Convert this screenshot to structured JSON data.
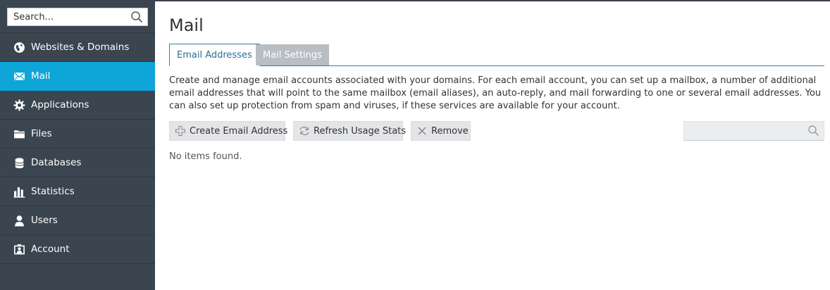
{
  "sidebar": {
    "search_placeholder": "Search...",
    "items": [
      {
        "label": "Websites & Domains",
        "icon": "globe-icon",
        "active": false
      },
      {
        "label": "Mail",
        "icon": "envelope-icon",
        "active": true
      },
      {
        "label": "Applications",
        "icon": "gear-icon",
        "active": false
      },
      {
        "label": "Files",
        "icon": "folder-icon",
        "active": false
      },
      {
        "label": "Databases",
        "icon": "database-icon",
        "active": false
      },
      {
        "label": "Statistics",
        "icon": "bar-chart-icon",
        "active": false
      },
      {
        "label": "Users",
        "icon": "user-icon",
        "active": false
      },
      {
        "label": "Account",
        "icon": "account-card-icon",
        "active": false
      }
    ]
  },
  "main": {
    "title": "Mail",
    "tabs": [
      {
        "label": "Email Addresses",
        "active": true
      },
      {
        "label": "Mail Settings",
        "active": false
      }
    ],
    "description": "Create and manage email accounts associated with your domains. For each email account, you can set up a mailbox, a number of additional email addresses that will point to the same mailbox (email aliases), an auto-reply, and mail forwarding to one or several email addresses. You can also set up protection from spam and viruses, if these services are available for your account.",
    "toolbar": {
      "create_label": "Create Email Address",
      "refresh_label": "Refresh Usage Stats",
      "remove_label": "Remove",
      "search_placeholder": ""
    },
    "empty_message": "No items found."
  },
  "colors": {
    "sidebar_bg": "#3a4550",
    "active_item_bg": "#0ea5d9",
    "tab_accent": "#2b7fa8",
    "inactive_tab_bg": "#b9bec3",
    "button_bg": "#e3e5e7"
  }
}
